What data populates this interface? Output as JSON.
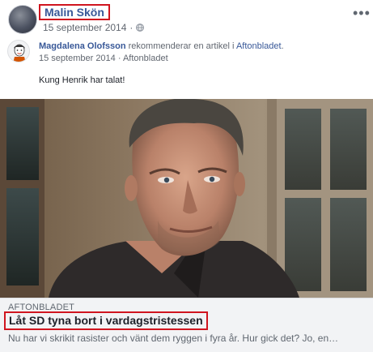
{
  "post": {
    "author": "Malin Skön",
    "date": "15 september 2014",
    "privacy_icon": "globe-icon",
    "menu_icon": "more-options-icon",
    "menu_label": "•••"
  },
  "shared": {
    "sharer_name": "Magdalena Olofsson",
    "action_text": "rekommenderar en artikel i",
    "publication_link": "Aftonbladet",
    "trailing": ".",
    "date": "15 september 2014",
    "separator": " · ",
    "source": "Aftonbladet",
    "comment": "Kung Henrik har talat!"
  },
  "article": {
    "source_label": "AFTONBLADET",
    "headline": "Låt SD tyna bort i vardagstristessen",
    "summary": "Nu har vi skrikit rasister och vänt dem ryggen i fyra år. Hur gick det? Jo, en…"
  },
  "colors": {
    "link": "#385898",
    "highlight_border": "#d0151f",
    "footer_bg": "#f2f3f5",
    "meta_text": "#616770"
  }
}
